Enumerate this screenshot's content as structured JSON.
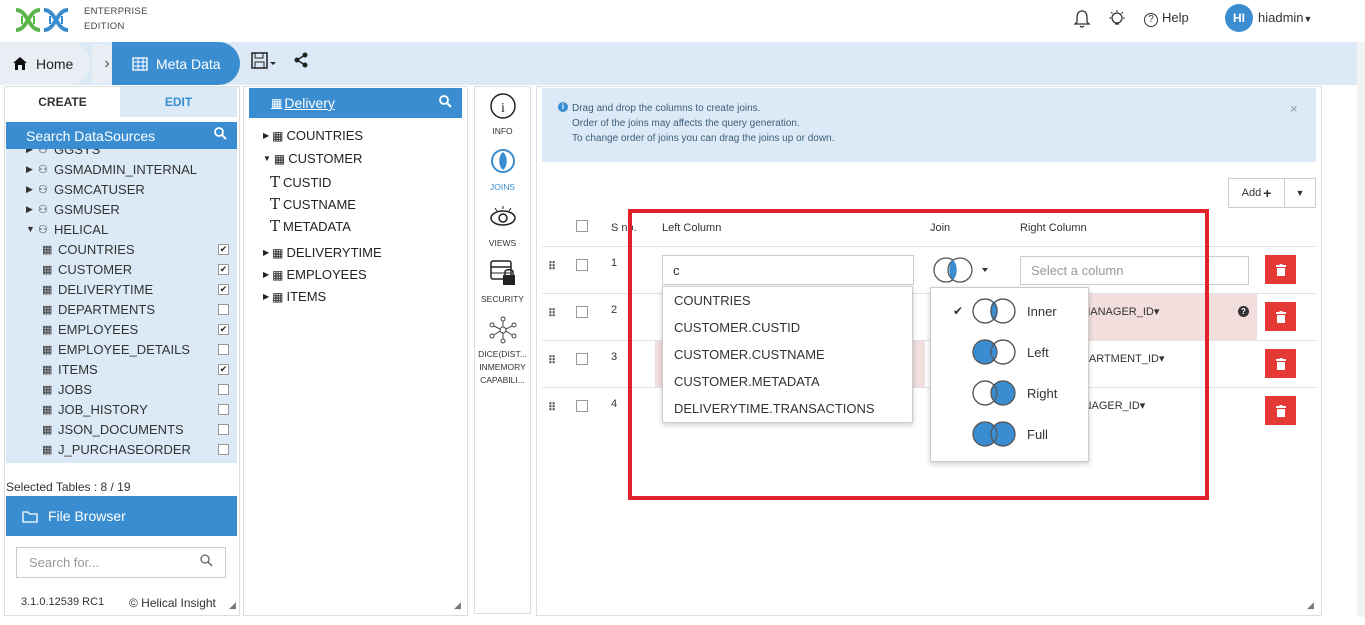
{
  "header": {
    "brand_line1": "ENTERPRISE",
    "brand_line2": "EDITION",
    "help_label": "Help",
    "avatar_initials": "HI",
    "username": "hiadmin"
  },
  "breadcrumb": {
    "home": "Home",
    "current": "Meta Data"
  },
  "left_panel": {
    "tab_create": "CREATE",
    "tab_edit": "EDIT",
    "search_title": "Search DataSources",
    "items": [
      {
        "label": "GGSYS",
        "kind": "schema",
        "checked": null
      },
      {
        "label": "GSMADMIN_INTERNAL",
        "kind": "schema",
        "checked": null
      },
      {
        "label": "GSMCATUSER",
        "kind": "schema",
        "checked": null
      },
      {
        "label": "GSMUSER",
        "kind": "schema",
        "checked": null
      },
      {
        "label": "HELICAL",
        "kind": "schema-open",
        "checked": null
      },
      {
        "label": "COUNTRIES",
        "kind": "table",
        "checked": true
      },
      {
        "label": "CUSTOMER",
        "kind": "table",
        "checked": true
      },
      {
        "label": "DELIVERYTIME",
        "kind": "table",
        "checked": true
      },
      {
        "label": "DEPARTMENTS",
        "kind": "table",
        "checked": false
      },
      {
        "label": "EMPLOYEES",
        "kind": "table",
        "checked": true
      },
      {
        "label": "EMPLOYEE_DETAILS",
        "kind": "table",
        "checked": false
      },
      {
        "label": "ITEMS",
        "kind": "table",
        "checked": true
      },
      {
        "label": "JOBS",
        "kind": "table",
        "checked": false
      },
      {
        "label": "JOB_HISTORY",
        "kind": "table",
        "checked": false
      },
      {
        "label": "JSON_DOCUMENTS",
        "kind": "table",
        "checked": false
      },
      {
        "label": "J_PURCHASEORDER",
        "kind": "table",
        "checked": false
      }
    ],
    "selected_tables": "Selected Tables : 8 / 19",
    "file_browser": "File Browser",
    "search_placeholder": "Search for...",
    "version": "3.1.0.12539 RC1",
    "copyright": "© Helical Insight"
  },
  "tree": {
    "title": "Delivery",
    "nodes": [
      {
        "label": "COUNTRIES",
        "kind": "table"
      },
      {
        "label": "CUSTOMER",
        "kind": "table-open"
      },
      {
        "label": "CUSTID",
        "kind": "column"
      },
      {
        "label": "CUSTNAME",
        "kind": "column"
      },
      {
        "label": "METADATA",
        "kind": "column"
      },
      {
        "label": "DELIVERYTIME",
        "kind": "table"
      },
      {
        "label": "EMPLOYEES",
        "kind": "table"
      },
      {
        "label": "ITEMS",
        "kind": "table"
      }
    ]
  },
  "side_icons": [
    {
      "label": "INFO",
      "icon": "info-icon"
    },
    {
      "label": "JOINS",
      "icon": "joins-icon"
    },
    {
      "label": "VIEWS",
      "icon": "eye-icon"
    },
    {
      "label": "SECURITY",
      "icon": "lock-table-icon"
    },
    {
      "label": "DICE(DIST... INMEMORY CAPABILI...",
      "icon": "network-icon"
    }
  ],
  "main": {
    "info_lines": [
      "Drag and drop the columns to create joins.",
      "Order of the joins may affects the query generation.",
      "To change order of joins you can drag the joins up or down."
    ],
    "add_label": "Add",
    "headers": {
      "sno": "S no.",
      "left": "Left Column",
      "join": "Join",
      "right": "Right Column"
    },
    "rows": [
      {
        "num": "1",
        "right": ""
      },
      {
        "num": "2",
        "right": "TS.MANAGER_ID"
      },
      {
        "num": "3",
        "right": ".DEPARTMENT_ID"
      },
      {
        "num": "4",
        "right": ".MANAGER_ID"
      }
    ],
    "left_input_value": "c",
    "right_placeholder": "Select a column",
    "left_options": [
      "COUNTRIES",
      "CUSTOMER.CUSTID",
      "CUSTOMER.CUSTNAME",
      "CUSTOMER.METADATA",
      "DELIVERYTIME.TRANSACTIONS"
    ],
    "join_options": [
      {
        "label": "Inner",
        "selected": true
      },
      {
        "label": "Left",
        "selected": false
      },
      {
        "label": "Right",
        "selected": false
      },
      {
        "label": "Full",
        "selected": false
      }
    ]
  }
}
